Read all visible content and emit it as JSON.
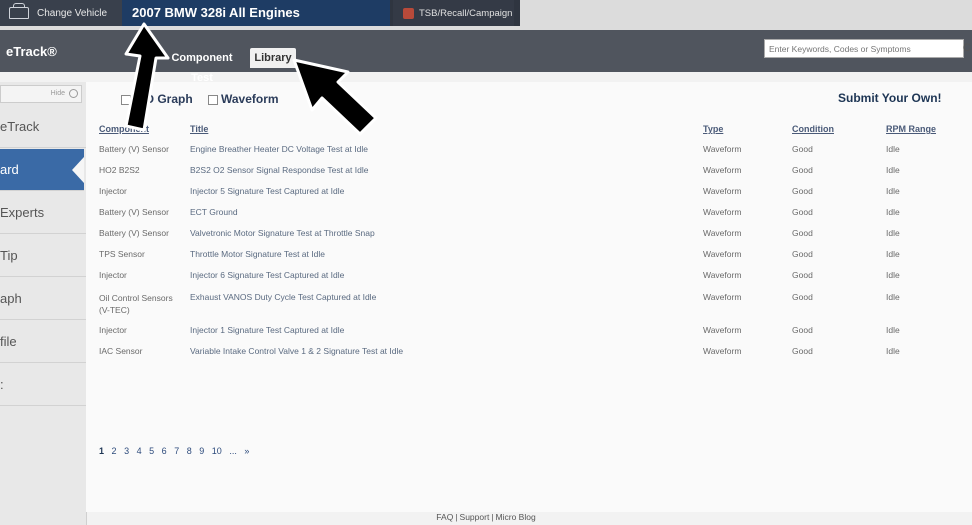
{
  "topbar": {
    "change_vehicle": "Change Vehicle",
    "vehicle": "2007 BMW 328i All Engines",
    "tsb": "TSB/Recall/Campaign"
  },
  "header": {
    "brand": "eTrack®",
    "tabs": [
      "Component Test",
      "Library"
    ],
    "active_tab": "Library",
    "search_placeholder": "Enter Keywords, Codes or Symptoms"
  },
  "sidebar": {
    "hide_label": "Hide",
    "items": [
      "eTrack",
      "ard",
      "Experts",
      "Tip",
      "aph",
      "file",
      ":"
    ],
    "active_index": 1
  },
  "filters": {
    "pid_graph": "PID Graph",
    "waveform": "Waveform",
    "submit": "Submit Your Own!"
  },
  "table": {
    "headers": [
      "Component",
      "Title",
      "Type",
      "Condition",
      "RPM Range"
    ],
    "rows": [
      [
        "Battery (V) Sensor",
        "Engine Breather Heater DC Voltage Test at Idle",
        "Waveform",
        "Good",
        "Idle"
      ],
      [
        "HO2 B2S2",
        "B2S2 O2 Sensor Signal Respondse Test at Idle",
        "Waveform",
        "Good",
        "Idle"
      ],
      [
        "Injector",
        "Injector 5 Signature Test Captured at Idle",
        "Waveform",
        "Good",
        "Idle"
      ],
      [
        "Battery (V) Sensor",
        "ECT Ground",
        "Waveform",
        "Good",
        "Idle"
      ],
      [
        "Battery (V) Sensor",
        "Valvetronic Motor Signature Test at Throttle Snap",
        "Waveform",
        "Good",
        "Idle"
      ],
      [
        "TPS Sensor",
        "Throttle Motor Signature Test at Idle",
        "Waveform",
        "Good",
        "Idle"
      ],
      [
        "Injector",
        "Injector 6 Signature Test Captured at Idle",
        "Waveform",
        "Good",
        "Idle"
      ],
      [
        "Oil Control Sensors (V-TEC)",
        "Exhaust VANOS Duty Cycle Test Captured at Idle",
        "Waveform",
        "Good",
        "Idle"
      ],
      [
        "Injector",
        "Injector 1 Signature Test Captured at Idle",
        "Waveform",
        "Good",
        "Idle"
      ],
      [
        "IAC Sensor",
        "Variable Intake Control Valve 1 & 2 Signature Test at Idle",
        "Waveform",
        "Good",
        "Idle"
      ]
    ]
  },
  "pagination": [
    "1",
    "2",
    "3",
    "4",
    "5",
    "6",
    "7",
    "8",
    "9",
    "10",
    "...",
    "»"
  ],
  "footer": [
    "FAQ",
    "Support",
    "Micro Blog"
  ]
}
